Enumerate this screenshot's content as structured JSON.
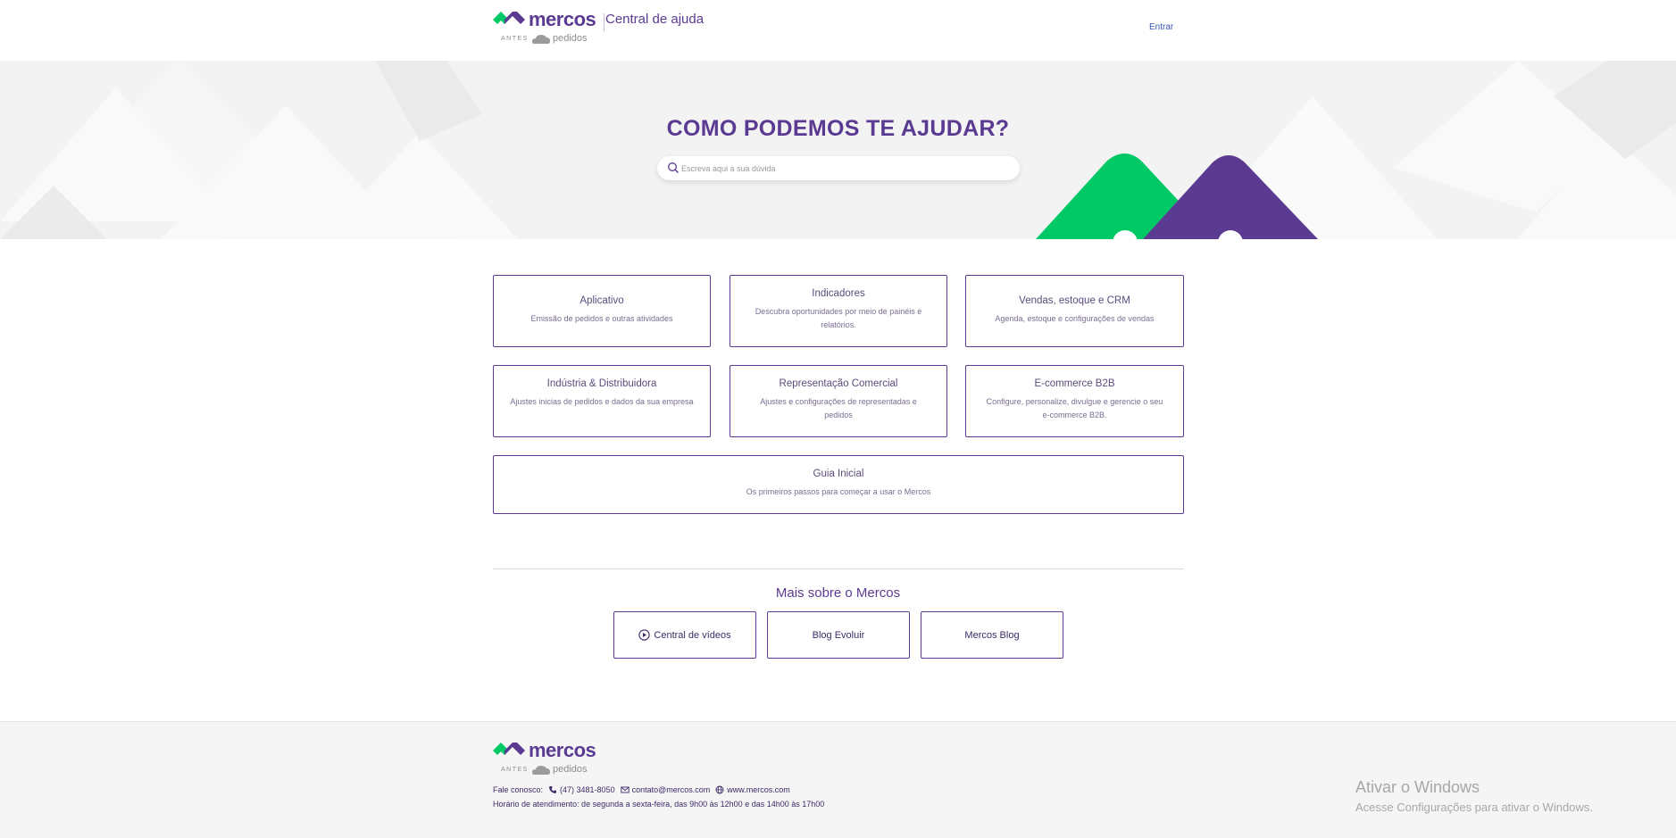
{
  "header": {
    "brand": "mercos",
    "antes": "ANTES",
    "formerly": "pedidos",
    "title": "Central de ajuda",
    "login": "Entrar"
  },
  "hero": {
    "heading": "COMO PODEMOS TE AJUDAR?",
    "search_placeholder": "Escreva aqui a sua dúvida"
  },
  "categories": [
    {
      "title": "Aplicativo",
      "desc": "Emissão de pedidos e outras atividades"
    },
    {
      "title": "Indicadores",
      "desc": "Descubra oportunidades por meio de painéis e relatórios."
    },
    {
      "title": "Vendas, estoque e CRM",
      "desc": "Agenda, estoque e configurações de vendas"
    },
    {
      "title": "Indústria & Distribuidora",
      "desc": "Ajustes inicias de pedidos e dados da sua empresa"
    },
    {
      "title": "Representação Comercial",
      "desc": "Ajustes e configurações de representadas e pedidos"
    },
    {
      "title": "E-commerce B2B",
      "desc": "Configure, personalize, divulgue e gerencie o seu e-commerce B2B."
    },
    {
      "title": "Guia Inicial",
      "desc": "Os primeiros passos para começar a usar o Mercos"
    }
  ],
  "more": {
    "title": "Mais sobre o Mercos",
    "buttons": [
      "Central de vídeos",
      "Blog Evoluir",
      "Mercos Blog"
    ]
  },
  "footer": {
    "brand": "mercos",
    "antes": "ANTES",
    "formerly": "pedidos",
    "contact_label": "Fale conosco:",
    "phone": "(47) 3481-8050",
    "email": "contato@mercos.com",
    "site": "www.mercos.com",
    "hours": "Horário de atendimento: de segunda a sexta-feira, das 9h00 às 12h00 e das 14h00 às 17h00"
  },
  "watermark": {
    "title": "Ativar o Windows",
    "subtitle": "Acesse Configurações para ativar o Windows."
  },
  "colors": {
    "brand_purple": "#5b3a91",
    "brand_green": "#00c965"
  }
}
